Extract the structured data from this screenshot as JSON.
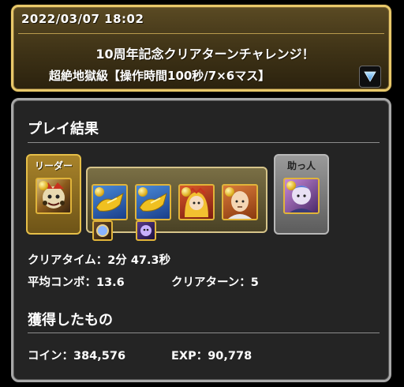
{
  "header": {
    "date": "2022/03/07 18:02",
    "title": "10周年記念クリアターンチャレンジ！",
    "subtitle": "超絶地獄級【操作時間100秒/7×6マス】",
    "dropdown_icon": "triangle-down-icon"
  },
  "result": {
    "section_title": "プレイ結果",
    "leader_label": "リーダー",
    "helper_label": "助っ人",
    "team": {
      "leader": "monster-leader-icon",
      "subs": [
        "monster-sub1-icon",
        "monster-sub2-icon",
        "monster-sub3-icon",
        "monster-sub4-icon"
      ],
      "assists": [
        "assist-1-icon",
        "assist-2-icon"
      ],
      "helper": "monster-helper-icon"
    },
    "clear_time": "クリアタイム：2分 47.3秒",
    "avg_combo": "平均コンボ：13.6",
    "clear_turns": "クリアターン：5"
  },
  "rewards": {
    "section_title": "獲得したもの",
    "coin": "コイン：384,576",
    "exp": "EXP：90,778"
  },
  "colors": {
    "header_border": "#e8c86a",
    "panel_border": "#a8a8a8",
    "panel_bg": "#242424"
  }
}
